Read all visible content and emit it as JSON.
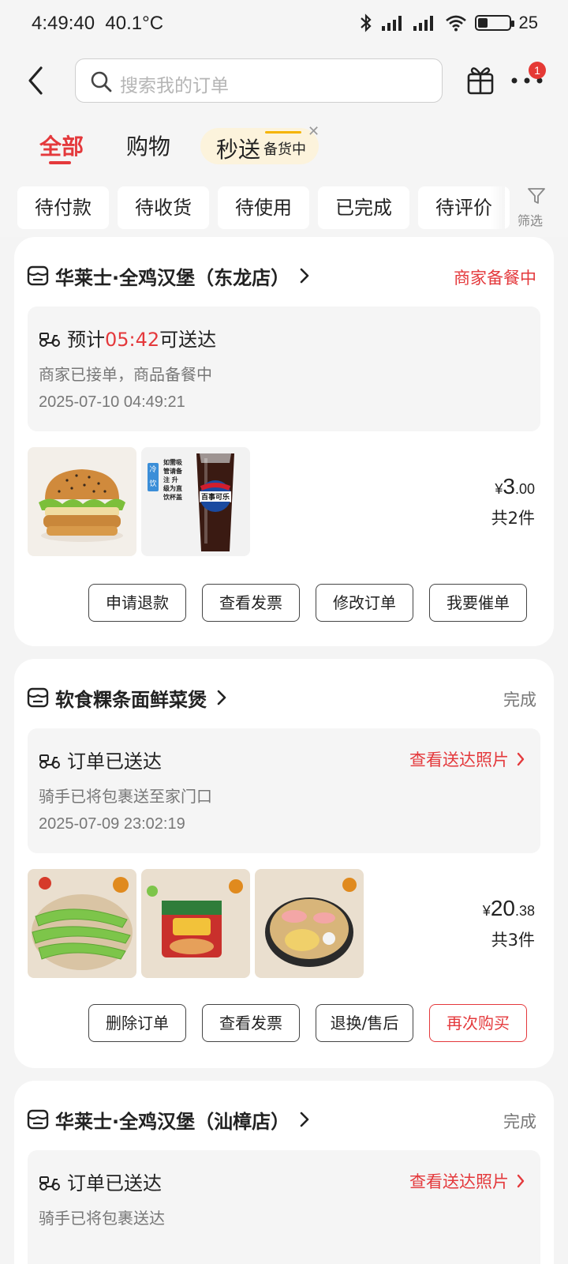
{
  "status_bar": {
    "time": "4:49:40",
    "temperature": "40.1°C",
    "battery": "25"
  },
  "header": {
    "search_placeholder": "搜索我的订单",
    "notification_count": "1"
  },
  "tabs": [
    {
      "label": "全部",
      "active": true
    },
    {
      "label": "购物",
      "active": false
    },
    {
      "label": "秒送",
      "active": false,
      "badge": "备货中"
    }
  ],
  "filters": [
    "待付款",
    "待收货",
    "待使用",
    "已完成",
    "待评价"
  ],
  "filter_button_label": "筛选",
  "orders": [
    {
      "store": "华莱士·全鸡汉堡（东龙店）",
      "status": "商家备餐中",
      "delivery_prefix": "预计",
      "delivery_eta": "05:42",
      "delivery_suffix": "可送达",
      "sub": "商家已接单，商品备餐中",
      "time": "2025-07-10 04:49:21",
      "price_symbol": "¥",
      "price_int": "3",
      "price_dec": ".00",
      "quantity": "共2件",
      "thumb_drink_tag": "冷饮",
      "thumb_drink_note": "如需吸管请备注 升级为直饮杯盖",
      "thumb_drink_brand": "百事可乐",
      "buttons": [
        "申请退款",
        "查看发票",
        "修改订单",
        "我要催单"
      ]
    },
    {
      "store": "软食粿条面鲜菜煲",
      "status": "完成",
      "delivery_title": "订单已送达",
      "link": "查看送达照片",
      "sub": "骑手已将包裹送至家门口",
      "time": "2025-07-09 23:02:19",
      "price_symbol": "¥",
      "price_int": "20",
      "price_dec": ".38",
      "quantity": "共3件",
      "buttons": [
        "删除订单",
        "查看发票",
        "退换/售后",
        "再次购买"
      ]
    },
    {
      "store": "华莱士·全鸡汉堡（汕樟店）",
      "status": "完成",
      "delivery_title": "订单已送达",
      "link": "查看送达照片",
      "sub": "骑手已将包裹送达"
    }
  ],
  "colors": {
    "accent": "#e4393c",
    "flash_bg": "#fcf3dc",
    "page_bg": "#f4f4f4"
  }
}
